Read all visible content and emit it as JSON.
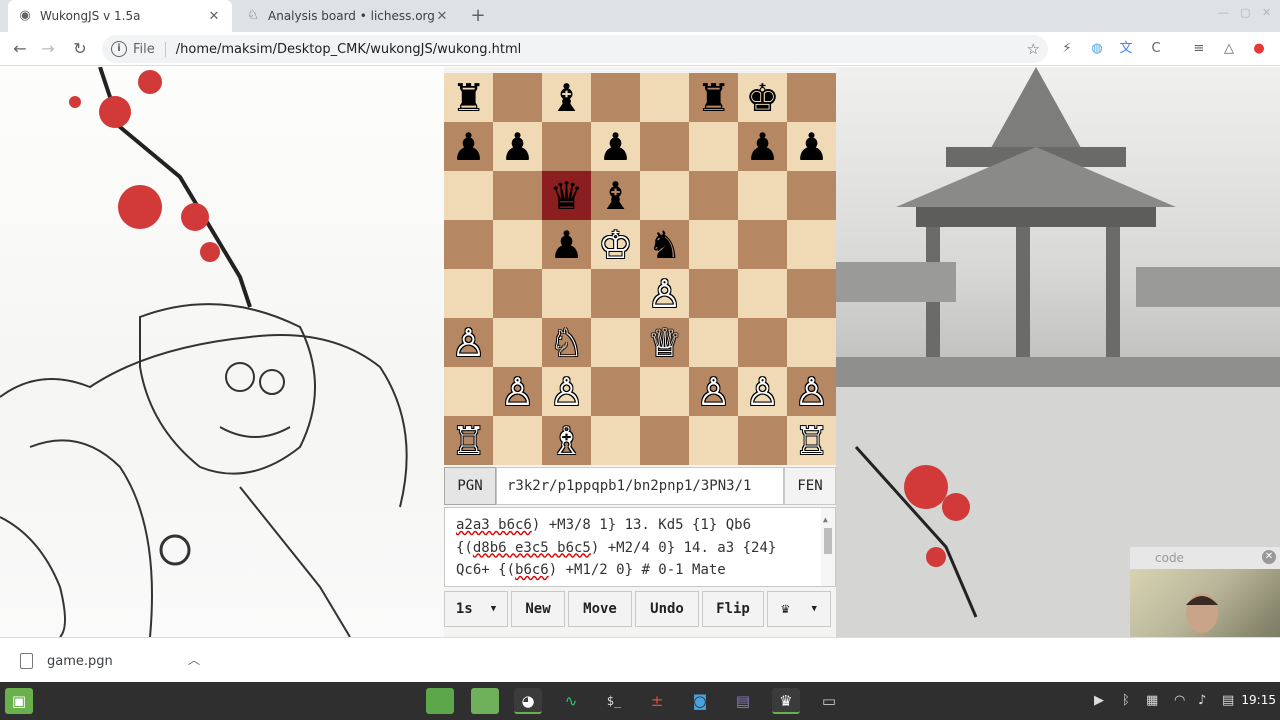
{
  "browser": {
    "tabs": [
      {
        "title": "WukongJS v 1.5a",
        "icon": "globe-icon",
        "active": true
      },
      {
        "title": "Analysis board • lichess.org",
        "icon": "lichess-icon",
        "active": false
      }
    ],
    "scheme": "File",
    "url": "/home/maksim/Desktop_CMK/wukongJS/wukong.html"
  },
  "board": {
    "highlight": "c6",
    "squares": [
      [
        "♜",
        "",
        "♝",
        "",
        "",
        "♜",
        "♚",
        ""
      ],
      [
        "♟",
        "♟",
        "",
        "♟",
        "",
        "",
        "♟",
        "♟"
      ],
      [
        "",
        "",
        "♛",
        "♝",
        "",
        "",
        "",
        ""
      ],
      [
        "",
        "",
        "♟",
        "♔",
        "♞",
        "",
        "",
        ""
      ],
      [
        "",
        "",
        "",
        "",
        "♙",
        "",
        "",
        ""
      ],
      [
        "♙",
        "",
        "♘",
        "",
        "♕",
        "",
        "",
        ""
      ],
      [
        "",
        "♙",
        "♙",
        "",
        "",
        "♙",
        "♙",
        "♙"
      ],
      [
        "♖",
        "",
        "♗",
        "",
        "",
        "",
        "",
        "♖"
      ]
    ]
  },
  "controls": {
    "pgn_label": "PGN",
    "fen_value": "r3k2r/p1ppqpb1/bn2pnp1/3PN3/1",
    "fen_label": "FEN",
    "pgn_lines": [
      [
        "a2a3 b6c6",
        ") +M3/8 1} 13. Kd5 {1} Qb6"
      ],
      [
        "{(",
        "d8b6 e3c5 b6c5",
        ") +M2/4 0} 14. a3 {24}"
      ],
      [
        "Qc6+ {(",
        "b6c6",
        ") +M1/2 0} # 0-1 Mate"
      ]
    ],
    "time_select": "1s",
    "new_label": "New",
    "move_label": "Move",
    "undo_label": "Undo",
    "flip_label": "Flip",
    "piece_select": "♛"
  },
  "webcam": {
    "title": "code"
  },
  "downloads": {
    "file": "game.pgn"
  },
  "taskbar": {
    "clock": "19:15"
  }
}
